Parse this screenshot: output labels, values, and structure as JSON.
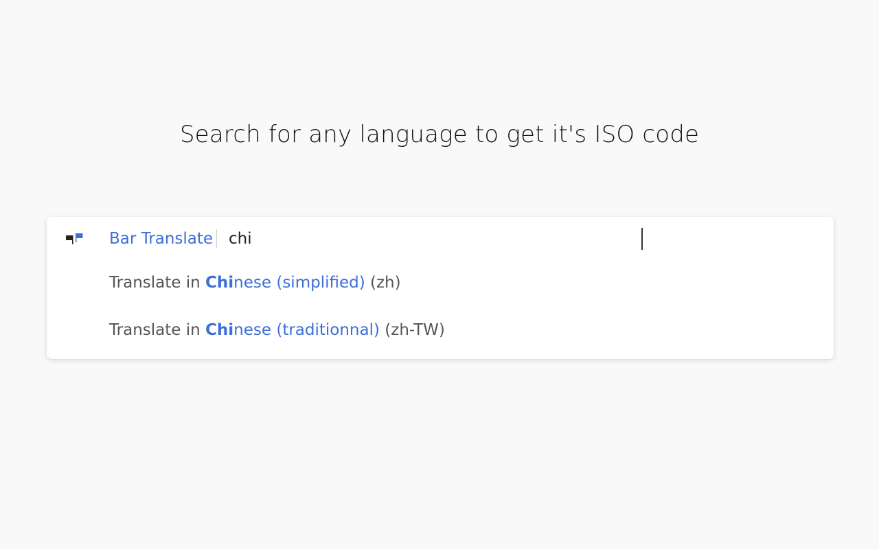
{
  "heading": "Search for any language to get it's ISO code",
  "omnibox": {
    "extension_name": "Bar Translate",
    "query": "chi",
    "icon": "flags-icon",
    "suggestions": [
      {
        "prefix": "Translate in ",
        "match": "Chi",
        "rest": "nese (simplified)",
        "code": "(zh)"
      },
      {
        "prefix": "Translate in ",
        "match": "Chi",
        "rest": "nese (traditionnal)",
        "code": "(zh-TW)"
      }
    ]
  },
  "colors": {
    "accent": "#3c6fd8",
    "background": "#f9f9f9",
    "muted_text": "#555555"
  }
}
